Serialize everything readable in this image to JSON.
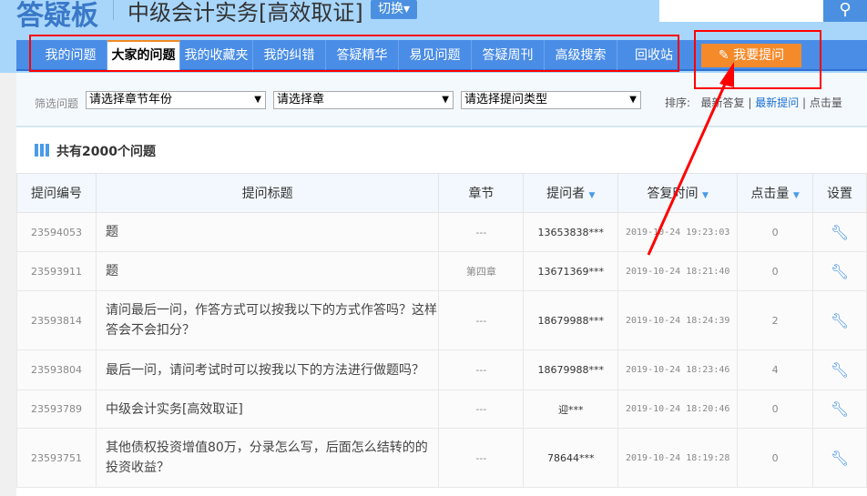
{
  "header": {
    "logo": "答疑板",
    "course": "中级会计实务[高效取证]",
    "switch_label": "切换▾"
  },
  "nav": {
    "items": [
      "我的问题",
      "大家的问题",
      "我的收藏夹",
      "我的纠错",
      "答疑精华",
      "易见问题",
      "答疑周刊",
      "高级搜索",
      "回收站"
    ],
    "active": 1,
    "ask_label": "我要提问"
  },
  "filter": {
    "label": "筛选问题",
    "selects": [
      "请选择章节年份",
      "请选择章",
      "请选择提问类型"
    ],
    "sort_label": "排序:",
    "sort_options": [
      "最新答复",
      "最新提问",
      "点击量"
    ],
    "sort_active": 1
  },
  "summary": "共有2000个问题",
  "table": {
    "headers": [
      "提问编号",
      "提问标题",
      "章节",
      "提问者",
      "答复时间",
      "点击量",
      "设置"
    ],
    "rows": [
      [
        "23594053",
        "题",
        "---",
        "13653838***",
        "2019-10-24 19:23:03",
        "0"
      ],
      [
        "23593911",
        "题",
        "第四章",
        "13671369***",
        "2019-10-24 18:21:40",
        "0"
      ],
      [
        "23593814",
        "请问最后一问，作答方式可以按我以下的方式作答吗？这样答会不会扣分？",
        "---",
        "18679988***",
        "2019-10-24 18:24:39",
        "2"
      ],
      [
        "23593804",
        "最后一问，请问考试时可以按我以下的方法进行做题吗？",
        "---",
        "18679988***",
        "2019-10-24 18:23:46",
        "4"
      ],
      [
        "23593789",
        "中级会计实务[高效取证]",
        "---",
        "迎***",
        "2019-10-24 18:20:46",
        "0"
      ],
      [
        "23593751",
        "其他债权投资增值80万，分录怎么写，后面怎么结转的的投资收益？",
        "---",
        "78644***",
        "2019-10-24 18:19:28",
        "0"
      ]
    ]
  },
  "colors": {
    "nav": "#4a8de6",
    "accent": "#f58a2b",
    "annotation": "#ff0000"
  }
}
